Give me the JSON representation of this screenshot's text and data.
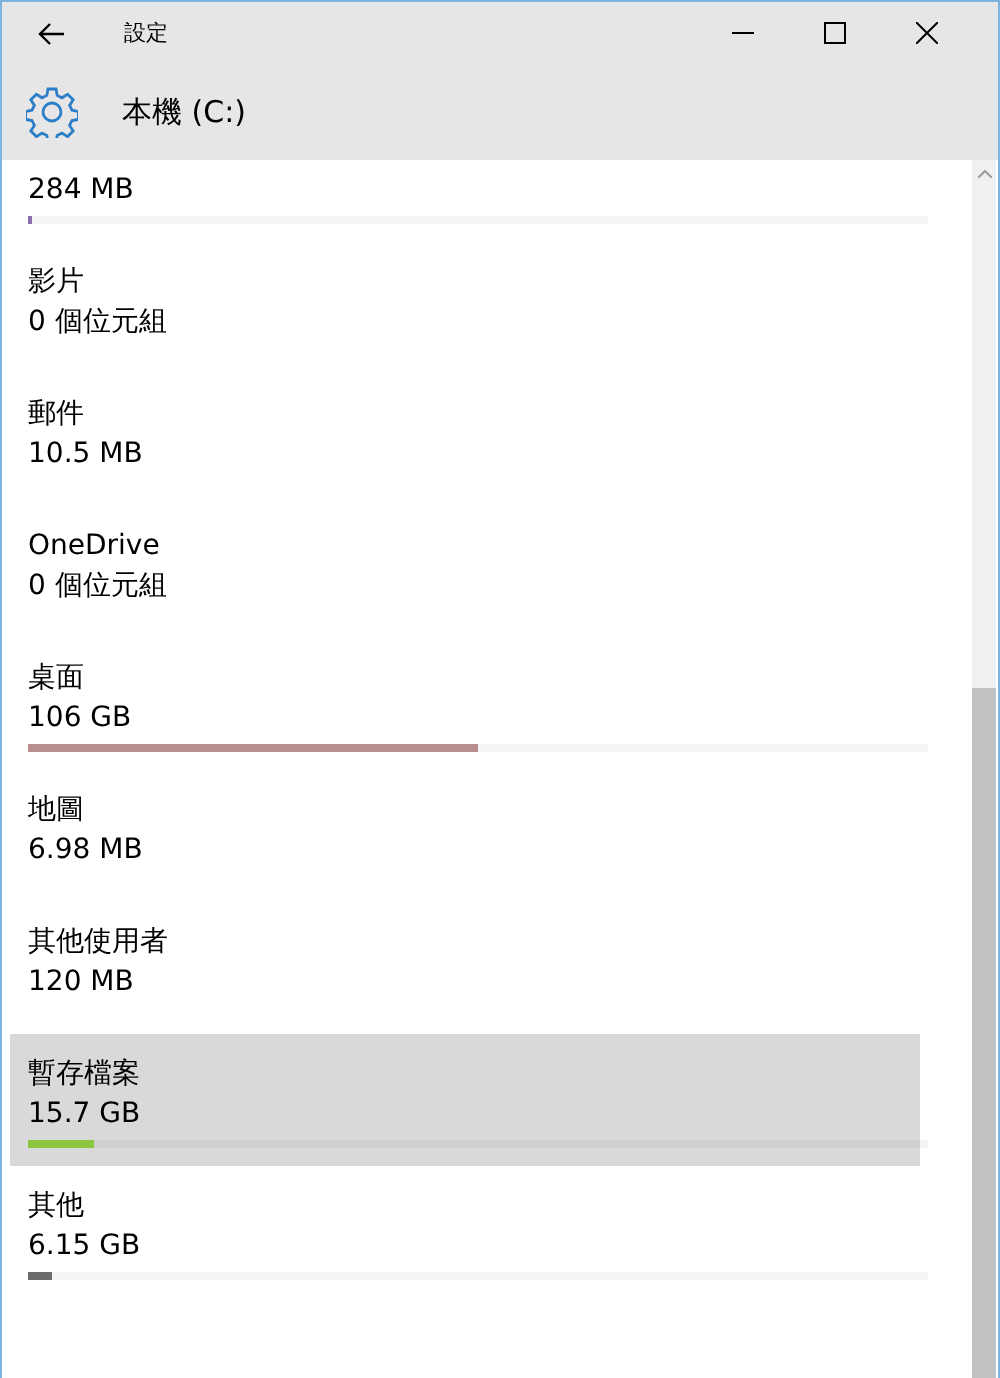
{
  "window": {
    "title": "設定"
  },
  "header": {
    "title": "本機 (C:)"
  },
  "items": [
    {
      "size": "284 MB",
      "level": 0.003,
      "color": "#8a6fb0",
      "selected": false
    },
    {
      "label": "影片",
      "size": "0 個位元組",
      "selected": false
    },
    {
      "label": "郵件",
      "size": "10.5 MB",
      "selected": false
    },
    {
      "label": "OneDrive",
      "size": "0 個位元組",
      "selected": false
    },
    {
      "label": "桌面",
      "size": "106 GB",
      "level": 0.5,
      "color": "#b98e8e",
      "selected": false
    },
    {
      "label": "地圖",
      "size": "6.98 MB",
      "selected": false
    },
    {
      "label": "其他使用者",
      "size": "120 MB",
      "selected": false
    },
    {
      "label": "暫存檔案",
      "size": "15.7 GB",
      "level": 0.073,
      "color": "#8cc63e",
      "selected": true
    },
    {
      "label": "其他",
      "size": "6.15 GB",
      "level": 0.027,
      "color": "#6b6b6b",
      "selected": false
    }
  ]
}
